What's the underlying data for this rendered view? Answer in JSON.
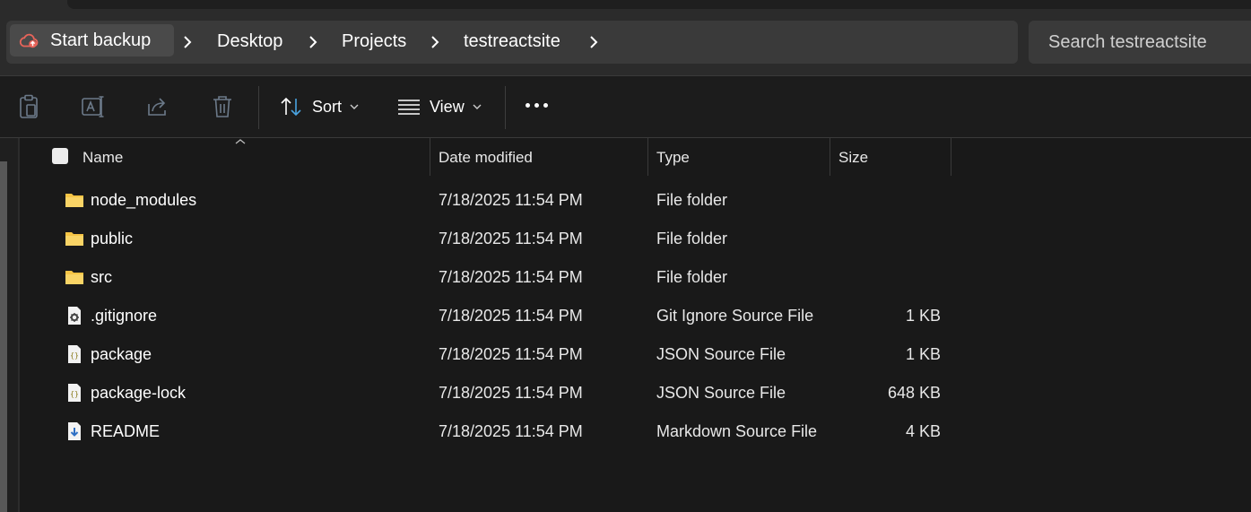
{
  "colors": {
    "window_bg": "#191919",
    "chrome_bg": "#2b2b2b",
    "address_bg": "#3a3a3a",
    "folder_yellow": "#f6c445",
    "backup_icon": "#e8645a"
  },
  "breadcrumb": {
    "start_label": "Start backup",
    "start_icon": "cloud-backup-icon",
    "items": [
      "Desktop",
      "Projects",
      "testreactsite"
    ]
  },
  "search": {
    "placeholder": "Search testreactsite"
  },
  "toolbar": {
    "buttons": [
      "paste-icon",
      "rename-icon",
      "share-icon",
      "delete-icon"
    ],
    "sort_label": "Sort",
    "view_label": "View",
    "more_icon": "more-icon"
  },
  "columns": {
    "name": "Name",
    "date": "Date modified",
    "type": "Type",
    "size": "Size"
  },
  "files": [
    {
      "icon": "folder-icon",
      "name": "node_modules",
      "date": "7/18/2025 11:54 PM",
      "type": "File folder",
      "size": ""
    },
    {
      "icon": "folder-icon",
      "name": "public",
      "date": "7/18/2025 11:54 PM",
      "type": "File folder",
      "size": ""
    },
    {
      "icon": "folder-icon",
      "name": "src",
      "date": "7/18/2025 11:54 PM",
      "type": "File folder",
      "size": ""
    },
    {
      "icon": "settings-file-icon",
      "name": ".gitignore",
      "date": "7/18/2025 11:54 PM",
      "type": "Git Ignore Source File",
      "size": "1 KB"
    },
    {
      "icon": "json-file-icon",
      "name": "package",
      "date": "7/18/2025 11:54 PM",
      "type": "JSON Source File",
      "size": "1 KB"
    },
    {
      "icon": "json-file-icon",
      "name": "package-lock",
      "date": "7/18/2025 11:54 PM",
      "type": "JSON Source File",
      "size": "648 KB"
    },
    {
      "icon": "markdown-file-icon",
      "name": "README",
      "date": "7/18/2025 11:54 PM",
      "type": "Markdown Source File",
      "size": "4 KB"
    }
  ]
}
